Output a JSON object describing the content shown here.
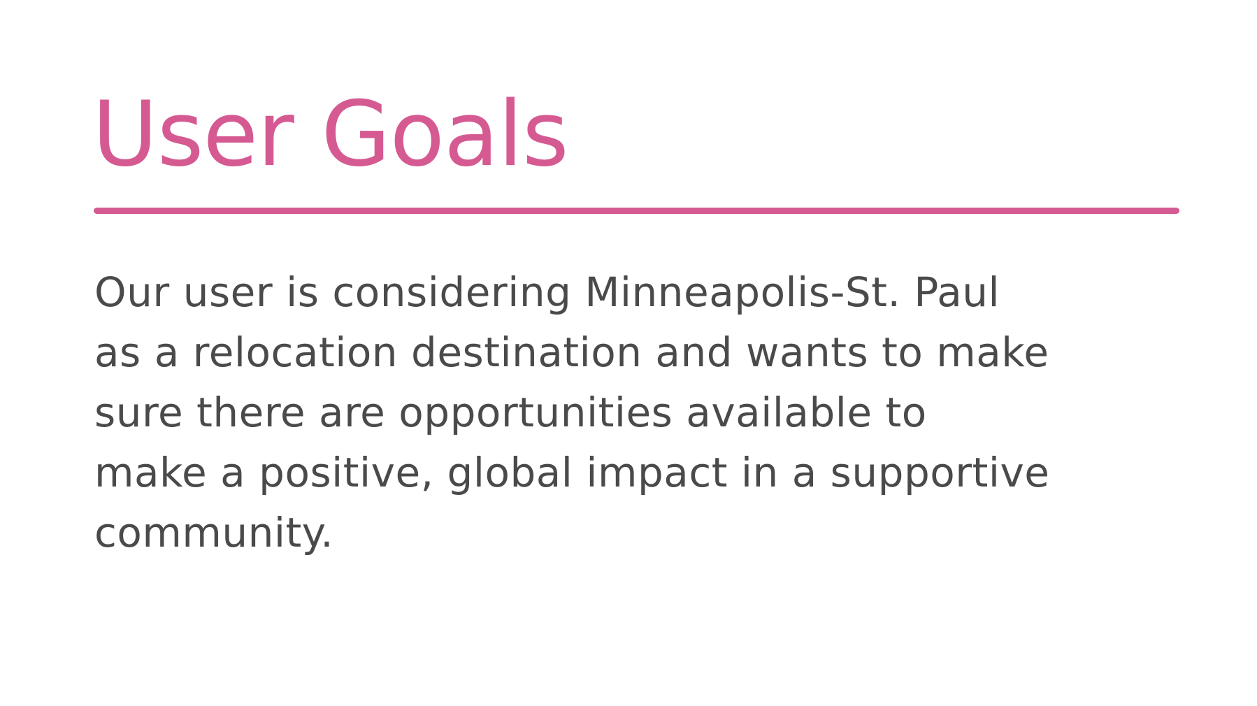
{
  "slide": {
    "title": "User Goals",
    "body_lines": [
      "Our user is considering Minneapolis-St. Paul",
      "as a relocation destination and wants to make",
      "sure there are opportunities available to",
      "make a positive, global impact in a supportive",
      "community."
    ]
  },
  "colors": {
    "accent": "#d65a92",
    "body_text": "#4a4a4a",
    "background": "#ffffff"
  }
}
